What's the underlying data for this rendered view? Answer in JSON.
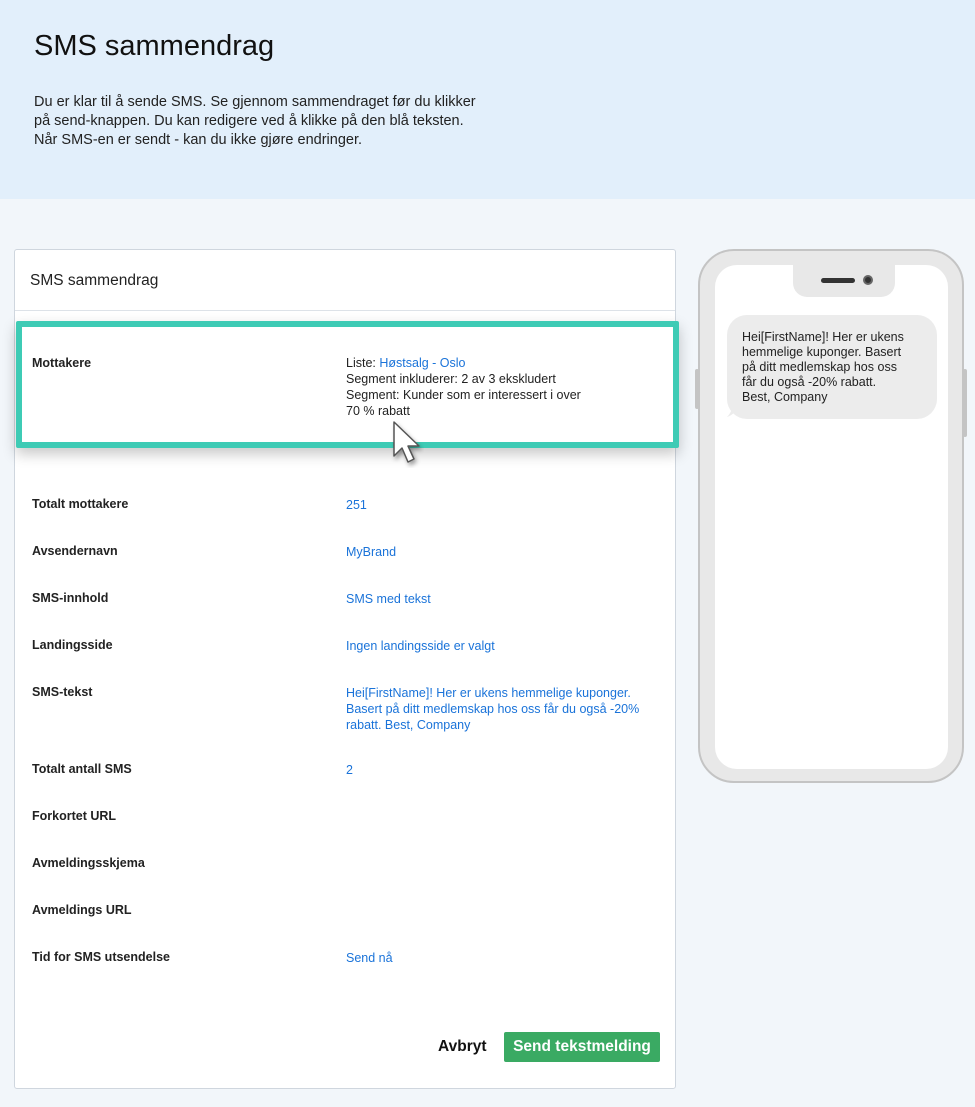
{
  "header": {
    "title": "SMS sammendrag",
    "intro": "Du er klar til å sende SMS. Se gjennom sammendraget før du klikker\npå send-knappen. Du kan redigere ved å klikke på den blå teksten.\nNår SMS-en er sendt - kan du ikke gjøre endringer."
  },
  "panel": {
    "title": "SMS sammendrag",
    "recipients": {
      "label": "Mottakere",
      "list_prefix": "Liste: ",
      "list_name": "Høstsalg - Oslo",
      "segment_includes": "Segment inkluderer: 2 av 3 ekskludert",
      "segment_line1": "Segment: Kunder som er interessert i over",
      "segment_line2": "70 % rabatt"
    },
    "rows": [
      {
        "label": "Totalt mottakere",
        "value": "251"
      },
      {
        "label": "Avsendernavn",
        "value": "MyBrand"
      },
      {
        "label": "SMS-innhold",
        "value": "SMS med tekst"
      },
      {
        "label": "Landingsside",
        "value": "Ingen landingsside er valgt"
      },
      {
        "label": "SMS-tekst",
        "value": "Hei[FirstName]! Her er ukens hemmelige kuponger. Basert på ditt medlemskap hos oss får du også -20% rabatt. Best, Company"
      },
      {
        "label": "Totalt antall SMS",
        "value": "2"
      },
      {
        "label": "Forkortet URL",
        "value": ""
      },
      {
        "label": "Avmeldingsskjema",
        "value": ""
      },
      {
        "label": "Avmeldings URL",
        "value": ""
      },
      {
        "label": "Tid for SMS utsendelse",
        "value": "Send nå"
      }
    ],
    "cancel_label": "Avbryt",
    "send_label": "Send tekstmelding"
  },
  "phone": {
    "message": "Hei[FirstName]! Her er ukens\nhemmelige kuponger. Basert\npå ditt medlemskap hos oss\nfår du også -20% rabatt.\nBest, Company"
  },
  "colors": {
    "header_bg": "#e2effb",
    "link": "#1a73d9",
    "highlight": "#3ecbb5",
    "send_button": "#3aaa63"
  }
}
